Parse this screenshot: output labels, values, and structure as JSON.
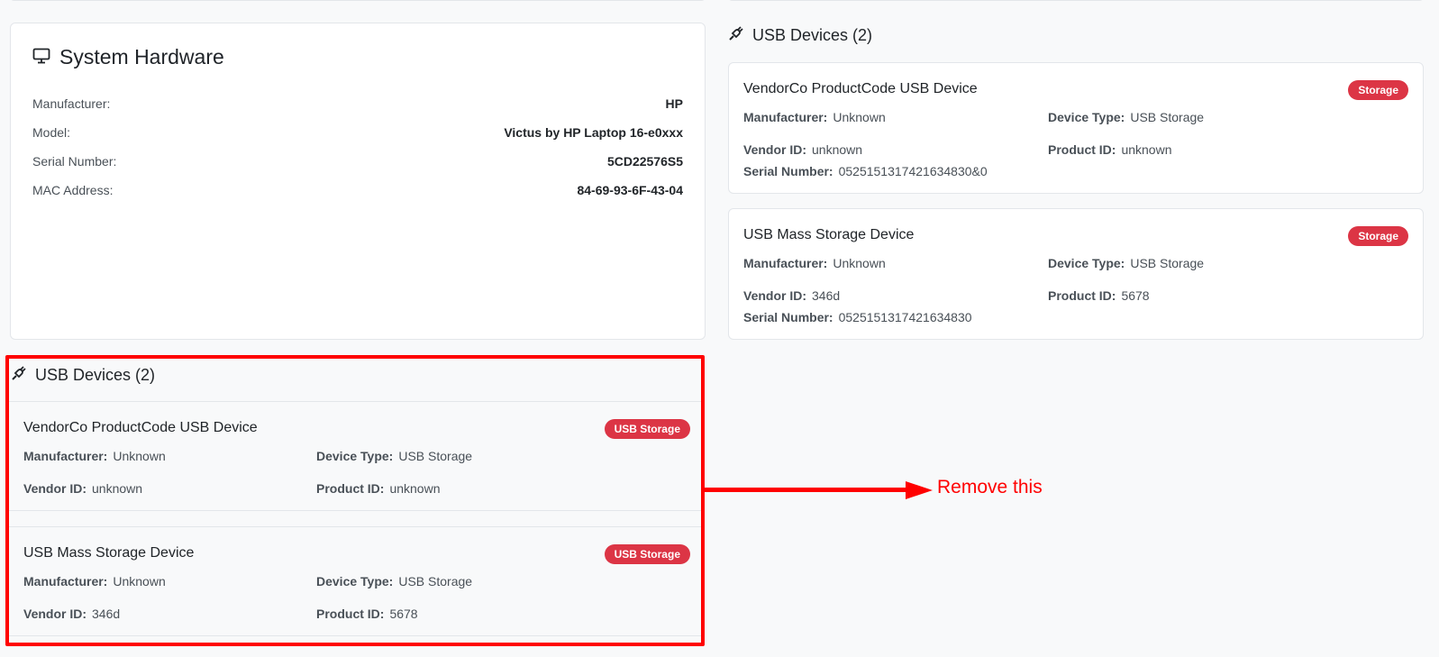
{
  "system_hardware": {
    "title": "System Hardware",
    "icon": "monitor-icon",
    "rows": [
      {
        "label": "Manufacturer:",
        "value": "HP"
      },
      {
        "label": "Model:",
        "value": "Victus by HP Laptop 16-e0xxx"
      },
      {
        "label": "Serial Number:",
        "value": "5CD22576S5"
      },
      {
        "label": "MAC Address:",
        "value": "84-69-93-6F-43-04"
      }
    ]
  },
  "usb_right": {
    "title": "USB Devices (2)",
    "icon": "usb-plug-icon",
    "devices": [
      {
        "name": "VendorCo ProductCode USB Device",
        "badge": "Storage",
        "manufacturer_label": "Manufacturer:",
        "manufacturer": "Unknown",
        "type_label": "Device Type:",
        "type": "USB Storage",
        "vendor_label": "Vendor ID:",
        "vendor": "unknown",
        "product_label": "Product ID:",
        "product": "unknown",
        "serial_label": "Serial Number:",
        "serial": "0525151317421634830&0"
      },
      {
        "name": "USB Mass Storage Device",
        "badge": "Storage",
        "manufacturer_label": "Manufacturer:",
        "manufacturer": "Unknown",
        "type_label": "Device Type:",
        "type": "USB Storage",
        "vendor_label": "Vendor ID:",
        "vendor": "346d",
        "product_label": "Product ID:",
        "product": "5678",
        "serial_label": "Serial Number:",
        "serial": "0525151317421634830"
      }
    ]
  },
  "usb_left": {
    "title": "USB Devices (2)",
    "icon": "usb-plug-icon",
    "devices": [
      {
        "name": "VendorCo ProductCode USB Device",
        "badge": "USB Storage",
        "manufacturer_label": "Manufacturer:",
        "manufacturer": "Unknown",
        "type_label": "Device Type:",
        "type": "USB Storage",
        "vendor_label": "Vendor ID:",
        "vendor": "unknown",
        "product_label": "Product ID:",
        "product": "unknown"
      },
      {
        "name": "USB Mass Storage Device",
        "badge": "USB Storage",
        "manufacturer_label": "Manufacturer:",
        "manufacturer": "Unknown",
        "type_label": "Device Type:",
        "type": "USB Storage",
        "vendor_label": "Vendor ID:",
        "vendor": "346d",
        "product_label": "Product ID:",
        "product": "5678"
      }
    ]
  },
  "annotation": {
    "label": "Remove this",
    "color": "#ff0000"
  },
  "colors": {
    "badge": "#dc3545",
    "background": "#f8f9fa"
  }
}
